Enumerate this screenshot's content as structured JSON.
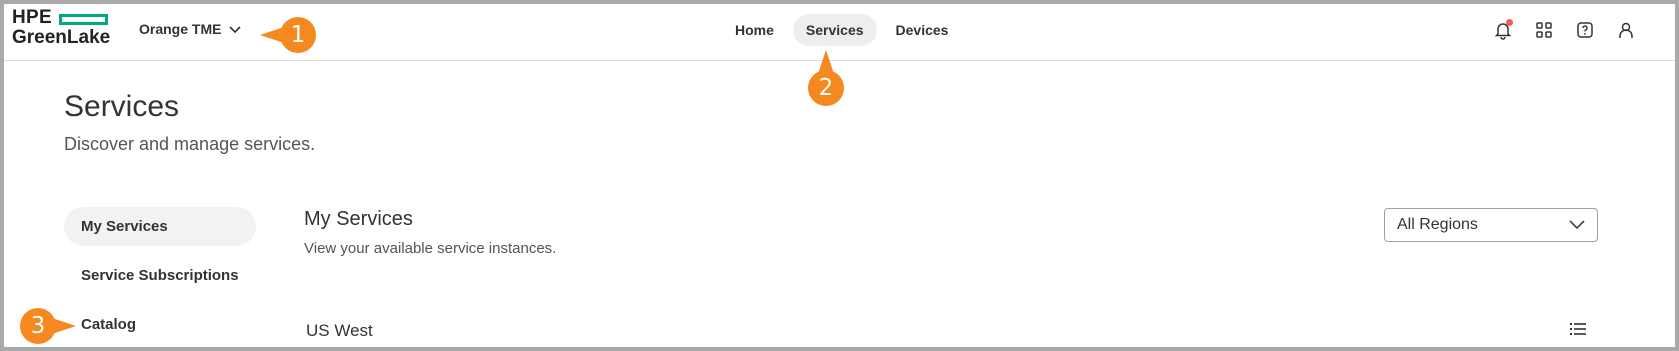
{
  "header": {
    "logo": {
      "line1": "HPE",
      "line2": "GreenLake"
    },
    "workspace": "Orange TME",
    "nav": [
      {
        "label": "Home"
      },
      {
        "label": "Services",
        "active": true
      },
      {
        "label": "Devices"
      }
    ],
    "icons": [
      "bell-icon",
      "apps-grid-icon",
      "help-icon",
      "user-icon"
    ]
  },
  "callouts": [
    "1",
    "2",
    "3"
  ],
  "page": {
    "title": "Services",
    "subtitle": "Discover and manage services."
  },
  "sidebar": {
    "items": [
      {
        "label": "My Services",
        "active": true
      },
      {
        "label": "Service Subscriptions"
      },
      {
        "label": "Catalog"
      }
    ]
  },
  "main": {
    "title": "My Services",
    "description": "View your available service instances.",
    "region_select": "All Regions",
    "section": "US West"
  },
  "colors": {
    "brand_green": "#01a982",
    "callout_orange": "#f5881f",
    "notification_red": "#fc5a5a"
  }
}
